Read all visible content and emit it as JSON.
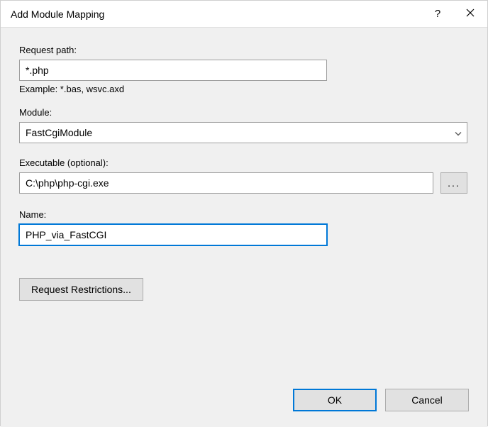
{
  "window": {
    "title": "Add Module Mapping"
  },
  "fields": {
    "request_path": {
      "label": "Request path:",
      "value": "*.php",
      "hint": "Example: *.bas, wsvc.axd"
    },
    "module": {
      "label": "Module:",
      "value": "FastCgiModule"
    },
    "executable": {
      "label": "Executable (optional):",
      "value": "C:\\php\\php-cgi.exe",
      "browse": "..."
    },
    "name": {
      "label": "Name:",
      "value": "PHP_via_FastCGI"
    }
  },
  "buttons": {
    "restrictions": "Request Restrictions...",
    "ok": "OK",
    "cancel": "Cancel"
  }
}
